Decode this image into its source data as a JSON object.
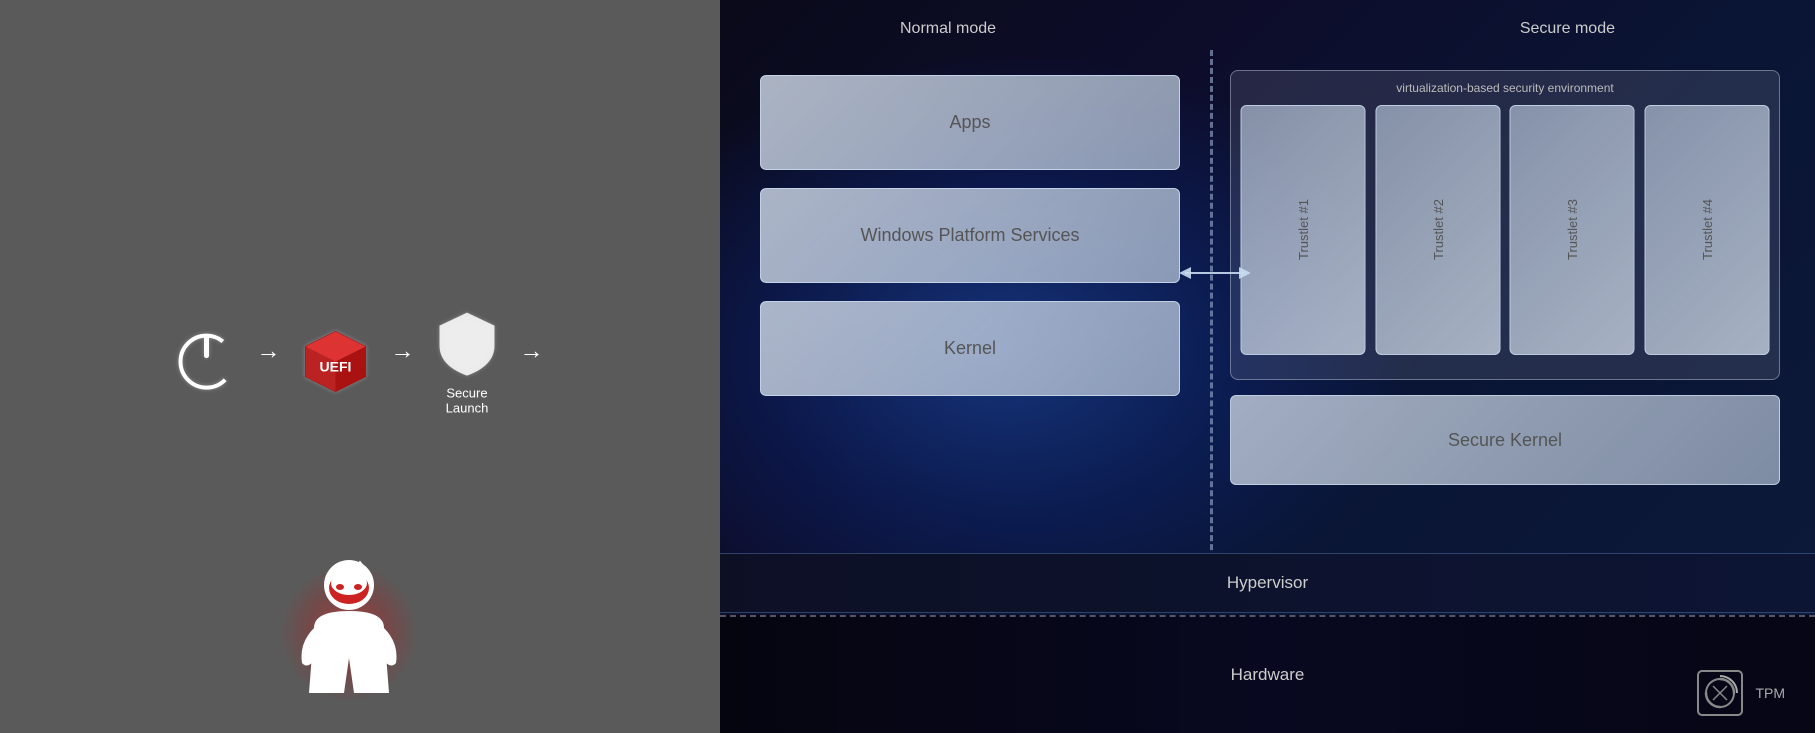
{
  "left": {
    "icons": {
      "power": "power-icon",
      "uefi": "uefi-icon",
      "shield": "shield-icon"
    },
    "labels": {
      "secure_launch": "Secure Launch"
    },
    "arrows": [
      "→",
      "→",
      "→"
    ]
  },
  "right": {
    "modes": {
      "normal": "Normal mode",
      "secure": "Secure mode"
    },
    "vbs_label": "virtualization-based security environment",
    "layers": {
      "apps": "Apps",
      "windows_platform_services": "Windows Platform Services",
      "kernel": "Kernel",
      "secure_kernel": "Secure Kernel",
      "hypervisor": "Hypervisor",
      "hardware": "Hardware"
    },
    "trustlets": [
      "Trustlet #1",
      "Trustlet #2",
      "Trustlet #3",
      "Trustlet #4"
    ],
    "tpm_label": "TPM"
  }
}
